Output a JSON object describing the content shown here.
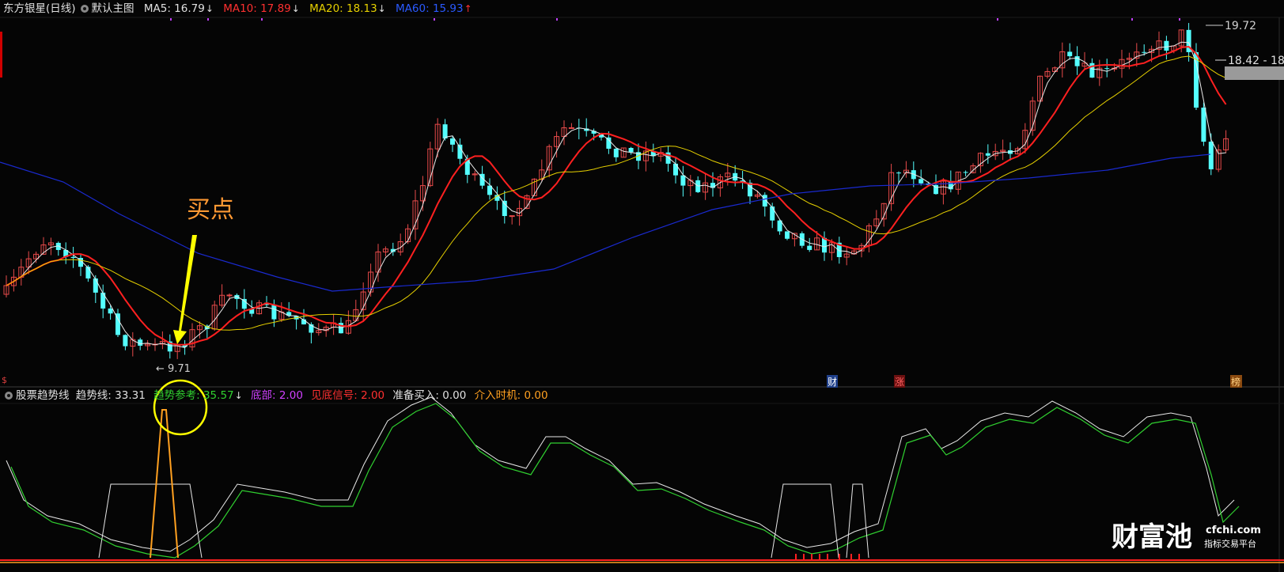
{
  "main_header": {
    "title": "东方银星(日线)",
    "template": "默认主图",
    "ma5_label": "MA5:",
    "ma5_value": "16.79",
    "ma5_dir": "↓",
    "ma10_label": "MA10:",
    "ma10_value": "17.89",
    "ma10_dir": "↓",
    "ma20_label": "MA20:",
    "ma20_value": "18.13",
    "ma20_dir": "↓",
    "ma60_label": "MA60:",
    "ma60_value": "15.93",
    "ma60_dir": "↑"
  },
  "sub_header": {
    "indicator_name": "股票趋势线",
    "trend_label": "趋势线:",
    "trend_value": "33.31",
    "trend_ref_label": "趋势参考:",
    "trend_ref_value": "35.57",
    "trend_ref_dir": "↓",
    "bottom_label": "底部:",
    "bottom_value": "2.00",
    "bottom_signal_label": "见底信号:",
    "bottom_signal_value": "2.00",
    "prepare_buy_label": "准备买入:",
    "prepare_buy_value": "0.00",
    "entry_time_label": "介入时机:",
    "entry_time_value": "0.00"
  },
  "price_labels": {
    "high": "19.72",
    "current": "18.42 - 18.",
    "low": "9.71"
  },
  "annotation": {
    "buy_point": "买点"
  },
  "event_markers": {
    "cai": "财",
    "zhang": "涨",
    "bang": "榜",
    "left_mark": "$"
  },
  "watermark": {
    "brand": "财富池",
    "domain": "cfchi.com",
    "tagline": "指标交易平台"
  },
  "colors": {
    "up_candle": "#e84a4a",
    "down_candle": "#54ffff",
    "ma5": "#e8e8e8",
    "ma10": "#ff2020",
    "ma20": "#e6d000",
    "ma60": "#1a2ad0",
    "annotation": "#ffff00",
    "buy_text": "#ff9933",
    "trend_line": "#e8e8e8",
    "trend_ref": "#30d030",
    "bottom_signal": "#ffa020"
  }
}
